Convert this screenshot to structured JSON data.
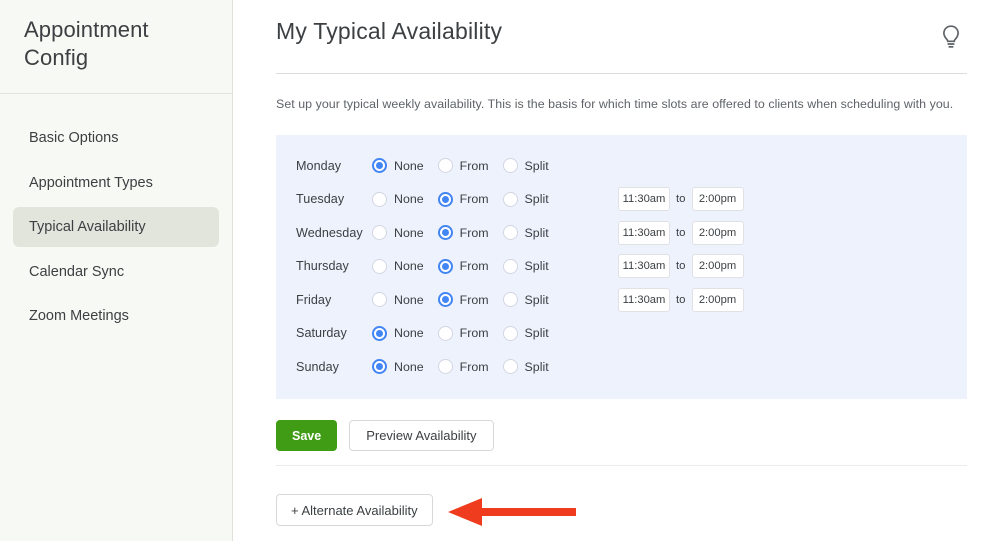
{
  "sidebar": {
    "title": "Appointment Config",
    "items": [
      {
        "label": "Basic Options",
        "active": false
      },
      {
        "label": "Appointment Types",
        "active": false
      },
      {
        "label": "Typical Availability",
        "active": true
      },
      {
        "label": "Calendar Sync",
        "active": false
      },
      {
        "label": "Zoom Meetings",
        "active": false
      }
    ]
  },
  "main": {
    "title": "My Typical Availability",
    "help_icon": "lightbulb-icon",
    "description": "Set up your typical weekly availability. This is the basis for which time slots are offered to clients when scheduling with you.",
    "radio_options": [
      "None",
      "From",
      "Split"
    ],
    "time_separator": "to",
    "availability": [
      {
        "day": "Monday",
        "mode": "None",
        "from": "",
        "to": ""
      },
      {
        "day": "Tuesday",
        "mode": "From",
        "from": "11:30am",
        "to": "2:00pm"
      },
      {
        "day": "Wednesday",
        "mode": "From",
        "from": "11:30am",
        "to": "2:00pm"
      },
      {
        "day": "Thursday",
        "mode": "From",
        "from": "11:30am",
        "to": "2:00pm"
      },
      {
        "day": "Friday",
        "mode": "From",
        "from": "11:30am",
        "to": "2:00pm"
      },
      {
        "day": "Saturday",
        "mode": "None",
        "from": "",
        "to": ""
      },
      {
        "day": "Sunday",
        "mode": "None",
        "from": "",
        "to": ""
      }
    ],
    "save_label": "Save",
    "preview_label": "Preview Availability",
    "alternate_label": "+ Alternate Availability"
  },
  "annotation": {
    "type": "arrow-left",
    "color": "#f03c1e",
    "points_to": "+ Alternate Availability"
  },
  "colors": {
    "sidebar_bg": "#f7faf4",
    "sidebar_active": "#e2e5dc",
    "panel_bg": "#eef2fd",
    "radio_selected": "#4285f4",
    "save_green": "#3f9c14",
    "arrow_red": "#f03c1e"
  }
}
